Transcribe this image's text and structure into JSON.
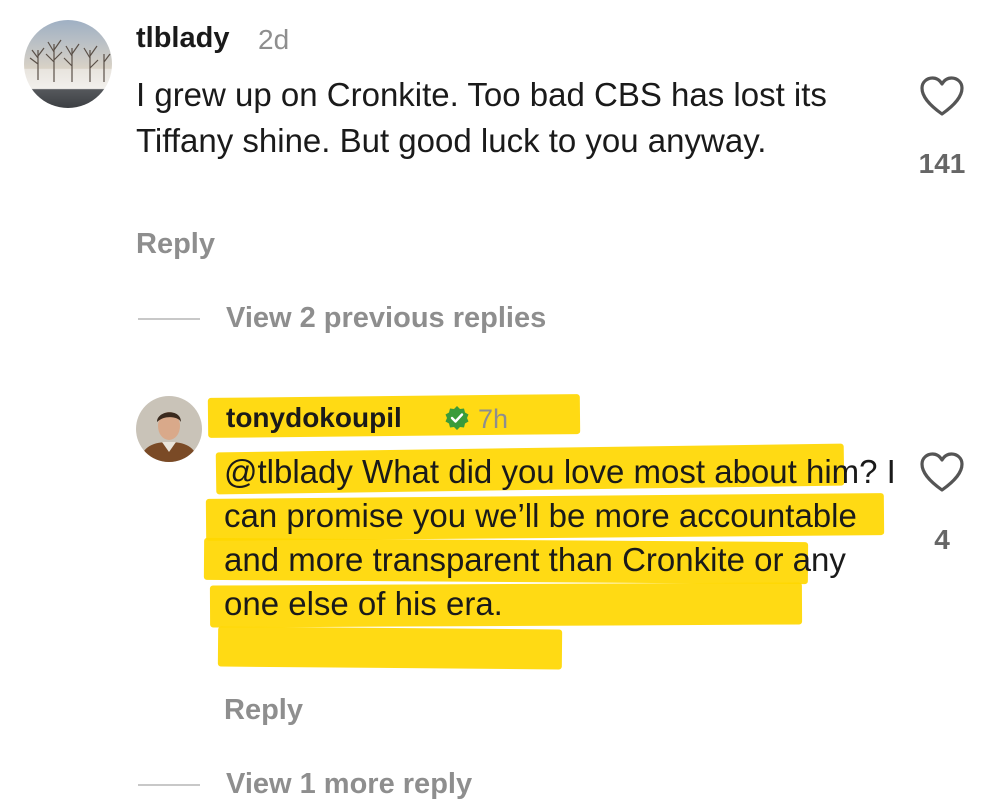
{
  "comment1": {
    "username": "tlblady",
    "time": "2d",
    "text": "I grew up on Cronkite. Too bad CBS has lost its Tiffany shine. But good luck to you anyway.",
    "reply_label": "Reply",
    "like_count": "141"
  },
  "view_previous": {
    "label": "View 2 previous replies"
  },
  "comment2": {
    "username": "tonydokoupil",
    "time": "7h",
    "mention": "@tlblady",
    "text": " What did you love most about him? I can promise you we’ll be more accountable and more transparent than Cronkite or any one else of his era.",
    "reply_label": "Reply",
    "like_count": "4",
    "verified": true
  },
  "view_more": {
    "label": "View 1 more reply"
  },
  "colors": {
    "highlight": "#ffd700",
    "verified_badge": "#3a9b3a",
    "secondary_text": "#8e8e8e"
  },
  "icons": {
    "like": "heart-outline-icon",
    "verified": "verified-badge-icon"
  }
}
